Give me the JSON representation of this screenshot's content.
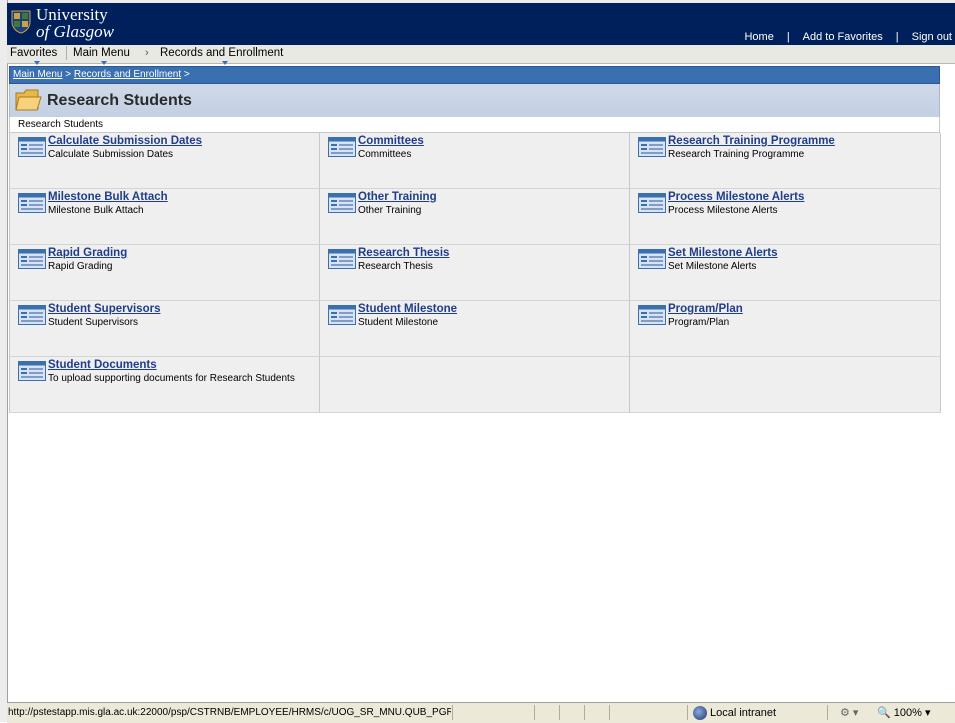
{
  "header": {
    "logo_line1": "University",
    "logo_line2": "of Glasgow",
    "links": {
      "home": "Home",
      "favorites": "Add to Favorites",
      "signout": "Sign out"
    }
  },
  "nav": {
    "favorites": "Favorites",
    "main_menu": "Main Menu",
    "arrow": "›",
    "records": "Records and Enrollment"
  },
  "breadcrumb": {
    "main_menu": "Main Menu",
    "sep1": " > ",
    "records": "Records and Enrollment",
    "sep2": " >"
  },
  "page": {
    "title": "Research Students",
    "subtitle": "Research Students"
  },
  "items": [
    {
      "link": "Calculate Submission Dates",
      "desc": "Calculate Submission Dates"
    },
    {
      "link": "Committees",
      "desc": "Committees"
    },
    {
      "link": "Research Training Programme",
      "desc": "Research Training Programme"
    },
    {
      "link": "Milestone Bulk Attach",
      "desc": "Milestone Bulk Attach"
    },
    {
      "link": "Other Training",
      "desc": "Other Training"
    },
    {
      "link": "Process Milestone Alerts",
      "desc": "Process Milestone Alerts"
    },
    {
      "link": "Rapid Grading",
      "desc": "Rapid Grading"
    },
    {
      "link": "Research Thesis",
      "desc": "Research Thesis"
    },
    {
      "link": "Set Milestone Alerts",
      "desc": "Set Milestone Alerts"
    },
    {
      "link": "Student Supervisors",
      "desc": "Student Supervisors"
    },
    {
      "link": "Student Milestone",
      "desc": "Student Milestone"
    },
    {
      "link": "Program/Plan",
      "desc": "Program/Plan"
    },
    {
      "link": "Student Documents",
      "desc": "To upload supporting documents for Research Students"
    }
  ],
  "statusbar": {
    "url": "http://pstestapp.mis.gla.ac.uk:22000/psp/CSTRNB/EMPLOYEE/HRMS/c/UOG_SR_MNU.QUB_PGR_TH",
    "zone": "Local intranet",
    "zoom": "100%",
    "zoom_arrow": "▾",
    "security_arrow": "▾"
  },
  "colors": {
    "banner": "#00205b",
    "breadcrumb_bar": "#3a6fb0",
    "link": "#1f3d8a",
    "cell_bg": "#efefef"
  }
}
